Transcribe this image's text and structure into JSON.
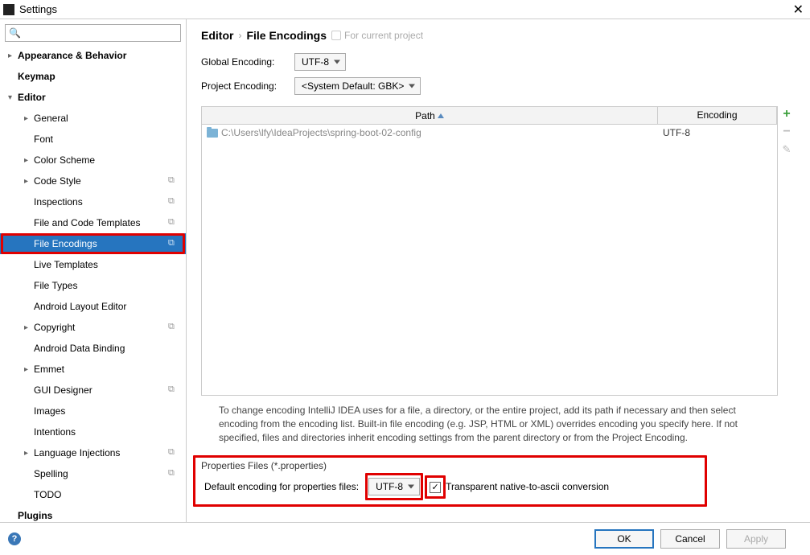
{
  "window": {
    "title": "Settings"
  },
  "search": {
    "placeholder": ""
  },
  "tree": {
    "items": [
      {
        "label": "Appearance & Behavior",
        "depth": 0,
        "expandable": true,
        "bold": true
      },
      {
        "label": "Keymap",
        "depth": 0,
        "expandable": false,
        "bold": true
      },
      {
        "label": "Editor",
        "depth": 0,
        "expandable": true,
        "bold": true,
        "expanded": true
      },
      {
        "label": "General",
        "depth": 1,
        "expandable": true
      },
      {
        "label": "Font",
        "depth": 1
      },
      {
        "label": "Color Scheme",
        "depth": 1,
        "expandable": true
      },
      {
        "label": "Code Style",
        "depth": 1,
        "expandable": true,
        "badge": true
      },
      {
        "label": "Inspections",
        "depth": 1,
        "badge": true
      },
      {
        "label": "File and Code Templates",
        "depth": 1,
        "badge": true
      },
      {
        "label": "File Encodings",
        "depth": 1,
        "badge": true,
        "selected": true
      },
      {
        "label": "Live Templates",
        "depth": 1
      },
      {
        "label": "File Types",
        "depth": 1
      },
      {
        "label": "Android Layout Editor",
        "depth": 1
      },
      {
        "label": "Copyright",
        "depth": 1,
        "expandable": true,
        "badge": true
      },
      {
        "label": "Android Data Binding",
        "depth": 1
      },
      {
        "label": "Emmet",
        "depth": 1,
        "expandable": true
      },
      {
        "label": "GUI Designer",
        "depth": 1,
        "badge": true
      },
      {
        "label": "Images",
        "depth": 1
      },
      {
        "label": "Intentions",
        "depth": 1
      },
      {
        "label": "Language Injections",
        "depth": 1,
        "expandable": true,
        "badge": true
      },
      {
        "label": "Spelling",
        "depth": 1,
        "badge": true
      },
      {
        "label": "TODO",
        "depth": 1
      },
      {
        "label": "Plugins",
        "depth": 0,
        "bold": true
      }
    ]
  },
  "breadcrumb": {
    "part1": "Editor",
    "part2": "File Encodings",
    "hint": "For current project"
  },
  "form": {
    "global_label": "Global Encoding:",
    "global_value": "UTF-8",
    "project_label": "Project Encoding:",
    "project_value": "<System Default: GBK>"
  },
  "table": {
    "col_path": "Path",
    "col_enc": "Encoding",
    "rows": [
      {
        "path": "C:\\Users\\lfy\\IdeaProjects\\spring-boot-02-config",
        "enc": "UTF-8"
      }
    ]
  },
  "note": "To change encoding IntelliJ IDEA uses for a file, a directory, or the entire project, add its path if necessary and then select encoding from the encoding list. Built-in file encoding (e.g. JSP, HTML or XML) overrides encoding you specify here. If not specified, files and directories inherit encoding settings from the parent directory or from the Project Encoding.",
  "section": {
    "title": "Properties Files (*.properties)",
    "props_label": "Default encoding for properties files:",
    "props_value": "UTF-8",
    "check_label": "Transparent native-to-ascii conversion",
    "checked": true
  },
  "buttons": {
    "ok": "OK",
    "cancel": "Cancel",
    "apply": "Apply"
  }
}
